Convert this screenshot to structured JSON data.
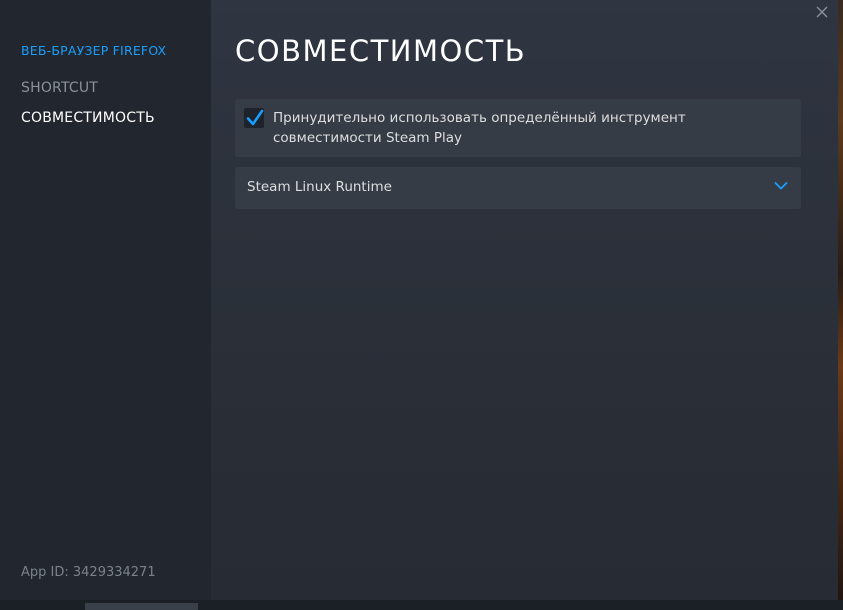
{
  "sidebar": {
    "game_title": "ВЕБ-БРАУЗЕР FIREFOX",
    "items": [
      {
        "label": "SHORTCUT",
        "active": false
      },
      {
        "label": "СОВМЕСТИМОСТЬ",
        "active": true
      }
    ],
    "app_id": "App ID: 3429334271"
  },
  "main": {
    "title": "СОВМЕСТИМОСТЬ",
    "force_compat": {
      "checked": true,
      "label": "Принудительно использовать определённый инструмент совместимости Steam Play"
    },
    "tool_select": {
      "selected": "Steam Linux Runtime"
    }
  },
  "icons": {
    "close": "close-icon",
    "check": "checkmark-icon",
    "chevron": "chevron-down-icon"
  },
  "colors": {
    "accent": "#1a9fff",
    "panel": "#363c46",
    "sidebar_bg": "#22262e",
    "text": "#dcdedf"
  }
}
